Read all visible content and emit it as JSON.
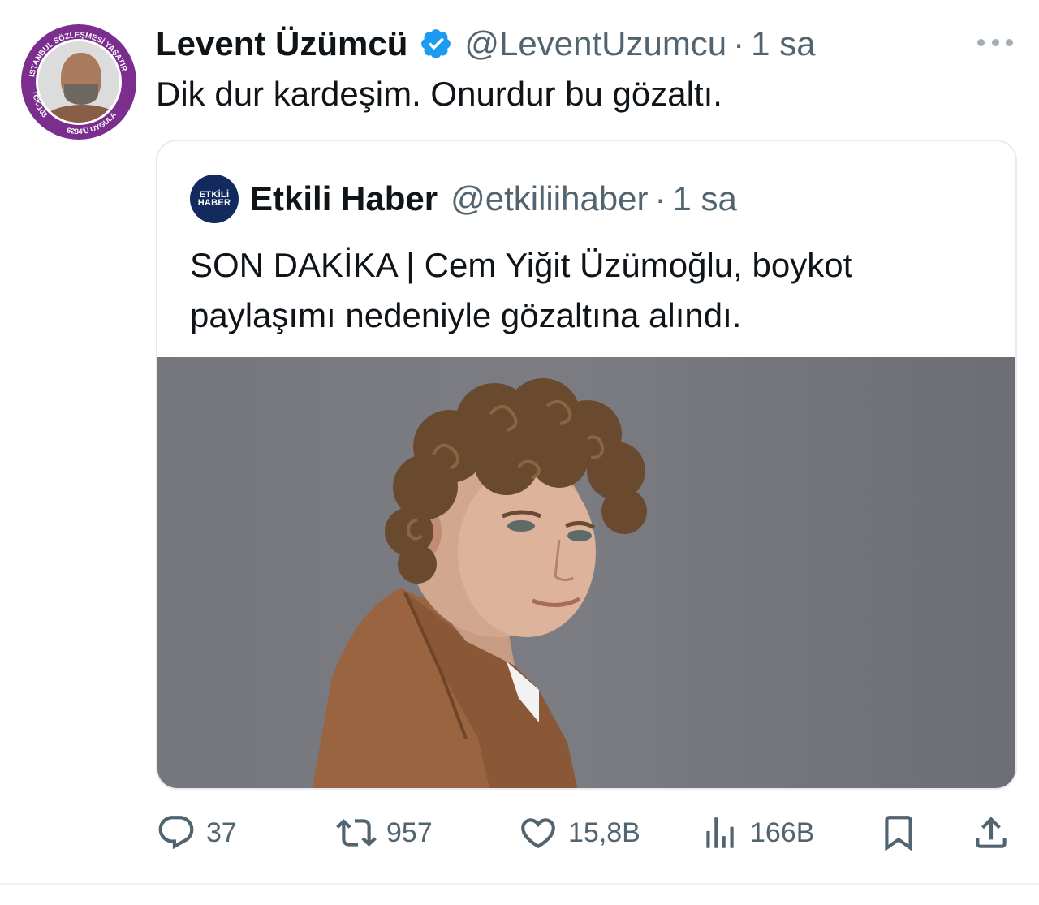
{
  "tweet": {
    "author": {
      "display_name": "Levent Üzümcü",
      "handle": "@LeventUzumcu",
      "time": "1 sa",
      "avatar_ring_text": [
        "İSTANBUL SÖZLEŞMESİ YAŞATIR",
        "TCK-103",
        "6284'Ü UYGULA"
      ],
      "verified": true
    },
    "separator": "·",
    "text": "Dik dur kardeşim. Onurdur bu gözaltı.",
    "quote": {
      "avatar_text": [
        "ETKİLİ",
        "HABER"
      ],
      "display_name": "Etkili Haber",
      "handle": "@etkiliihaber",
      "time": "1 sa",
      "text_lines": [
        "SON DAKİKA | Cem Yiğit Üzümoğlu, boykot",
        "paylaşımı nedeniyle gözaltına alındı."
      ]
    },
    "actions": {
      "replies": "37",
      "reposts": "957",
      "likes": "15,8B",
      "views": "166B"
    },
    "colors": {
      "text": "#0f1419",
      "secondary": "#536471",
      "verified": "#1d9bf0",
      "avatar_ring": "#7b2e8e"
    }
  }
}
